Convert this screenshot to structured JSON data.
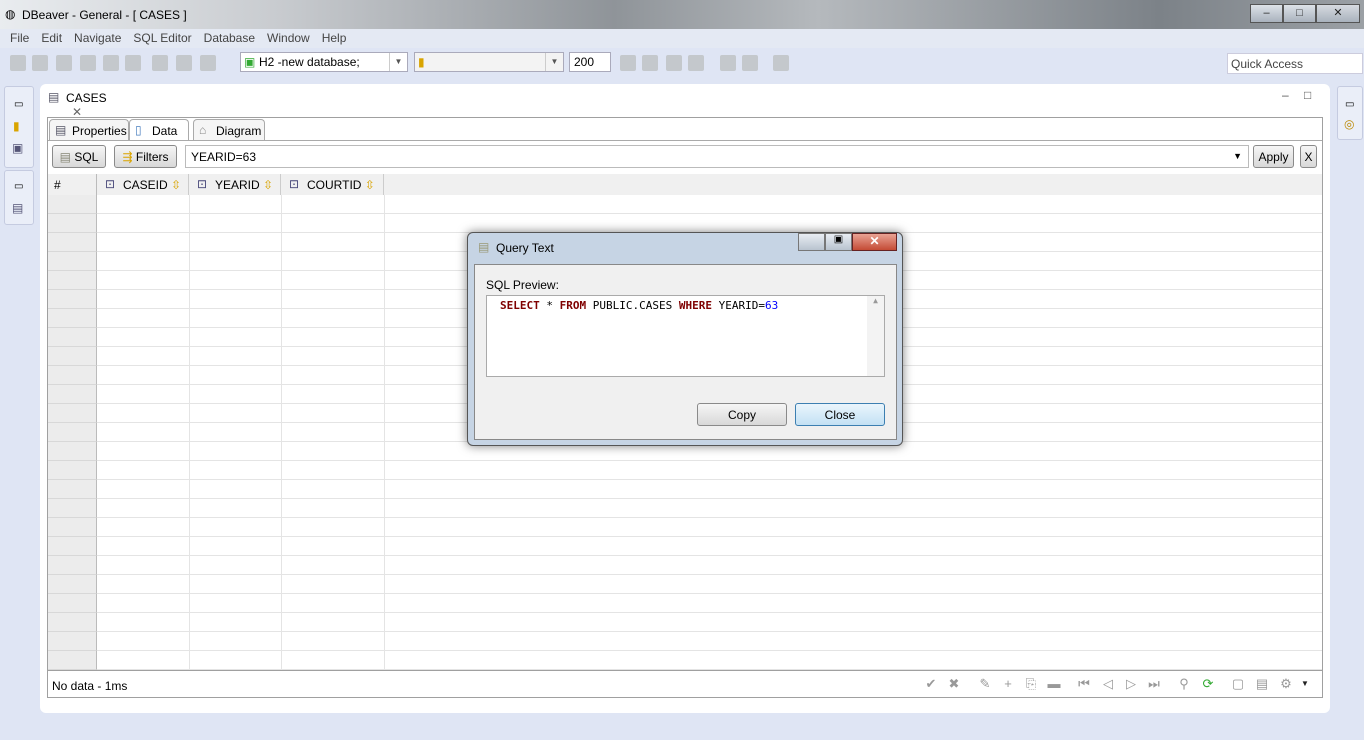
{
  "window": {
    "title": "DBeaver - General - [ CASES ]",
    "minimize": "–",
    "maximize": "□",
    "close": "✕"
  },
  "menu": [
    "File",
    "Edit",
    "Navigate",
    "SQL Editor",
    "Database",
    "Window",
    "Help"
  ],
  "toolbar": {
    "connection": "H2 -new database;",
    "schema": "",
    "fetch_size": "200",
    "quick_access": "Quick Access"
  },
  "editor": {
    "tab_label": "CASES",
    "subtabs": [
      "Properties",
      "Data",
      "Diagram"
    ],
    "active_subtab": "Data"
  },
  "filter": {
    "sql_label": "SQL",
    "filters_label": "Filters",
    "value": "YEARID=63",
    "apply_label": "Apply",
    "clear_label": "X"
  },
  "grid": {
    "row_header": "#",
    "columns": [
      "CASEID",
      "YEARID",
      "COURTID"
    ]
  },
  "status": {
    "text": "No data - 1ms"
  },
  "dialog": {
    "title": "Query Text",
    "label": "SQL Preview:",
    "sql": {
      "k1": "SELECT",
      "star": " * ",
      "k2": "FROM",
      "table": " PUBLIC.CASES ",
      "k3": "WHERE",
      "cond": " YEARID=",
      "val": "63"
    },
    "copy_label": "Copy",
    "close_label": "Close"
  },
  "colors": {
    "background": "#dfe5f4",
    "keyword": "#7f0000",
    "number": "#0000ff",
    "primary_button_border": "#3c7fb1"
  }
}
